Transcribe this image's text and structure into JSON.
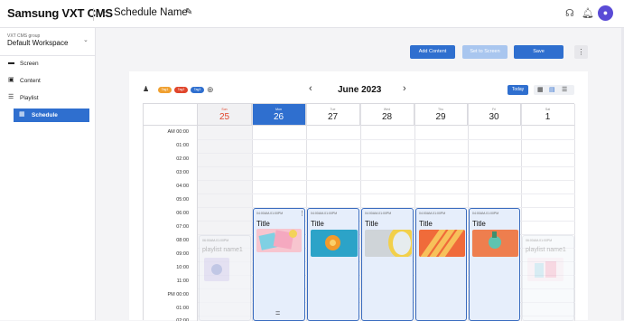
{
  "app": {
    "brand": "Samsung VXT CMS",
    "back_icon": "chevron-left-icon",
    "schedule_name": "Schedule Name",
    "edit_icon": "pencil-icon",
    "user_initial": "●"
  },
  "sidebar": {
    "group_label": "VXT CMS group",
    "workspace": "Default Workspace",
    "items": [
      {
        "label": "Screen",
        "icon": "screen-icon",
        "active": false
      },
      {
        "label": "Content",
        "icon": "content-icon",
        "active": false
      },
      {
        "label": "Playlist",
        "icon": "playlist-icon",
        "active": false
      },
      {
        "label": "Schedule",
        "icon": "schedule-icon",
        "active": true
      }
    ]
  },
  "toolbar": {
    "add_content": "Add Content",
    "set_to_screen": "Set to Screen",
    "save": "Save",
    "more": "⋮"
  },
  "calendar": {
    "month": "June 2023",
    "prev": "‹",
    "next": "›",
    "today": "Today",
    "tags": [
      "Tag1",
      "Tag2",
      "Tag3"
    ],
    "days": [
      {
        "name": "Sun",
        "date": "25"
      },
      {
        "name": "Mon",
        "date": "26"
      },
      {
        "name": "Tue",
        "date": "27"
      },
      {
        "name": "Wed",
        "date": "28"
      },
      {
        "name": "Thu",
        "date": "29"
      },
      {
        "name": "Fri",
        "date": "30"
      },
      {
        "name": "Sat",
        "date": "1"
      }
    ],
    "times": [
      "AM  00:00",
      "01:00",
      "02:00",
      "03:00",
      "04:00",
      "05:00",
      "06:00",
      "07:00",
      "08:00",
      "09:00",
      "10:00",
      "11:00",
      "PM  00:00",
      "01:00",
      "02:00"
    ],
    "events": [
      {
        "time": "04:00AM-01:00PM",
        "title": "Title"
      },
      {
        "time": "04:00AM-01:00PM",
        "title": "Title"
      },
      {
        "time": "04:00AM-01:00PM",
        "title": "Title"
      },
      {
        "time": "04:00AM-01:00PM",
        "title": "Title"
      },
      {
        "time": "04:00AM-01:00PM",
        "title": "Title"
      }
    ],
    "faded_events": [
      {
        "time": "06:00AM-01:00PM",
        "title": "playlist name1"
      },
      {
        "time": "06:00AM-01:00PM",
        "title": "playlist name1"
      }
    ],
    "event_more": "⋮",
    "drag_handle": "="
  },
  "colors": {
    "accent": "#2f6fcf",
    "sunday": "#e0452b"
  }
}
